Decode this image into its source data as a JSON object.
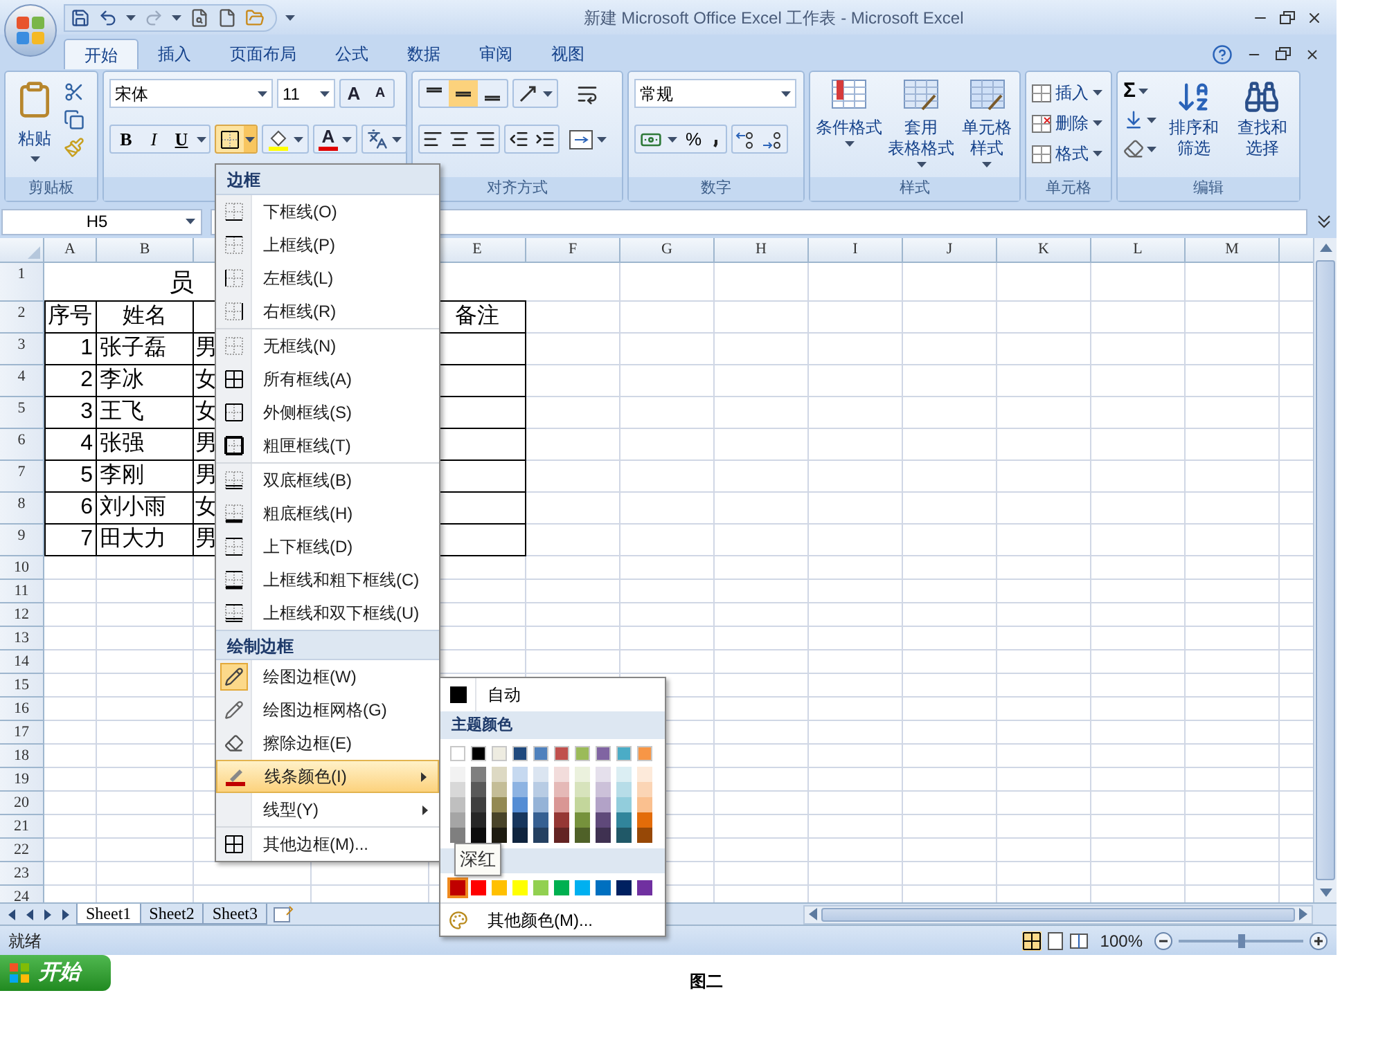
{
  "window": {
    "title": "新建 Microsoft Office Excel 工作表 - Microsoft Excel"
  },
  "tabs": [
    {
      "label": "开始",
      "selected": true
    },
    {
      "label": "插入",
      "selected": false
    },
    {
      "label": "页面布局",
      "selected": false
    },
    {
      "label": "公式",
      "selected": false
    },
    {
      "label": "数据",
      "selected": false
    },
    {
      "label": "审阅",
      "selected": false
    },
    {
      "label": "视图",
      "selected": false
    }
  ],
  "ribbon": {
    "clipboard": {
      "paste": "粘贴",
      "label": "剪贴板"
    },
    "font": {
      "name": "宋体",
      "size": "11",
      "grow": "A",
      "shrink": "A",
      "bold": "B",
      "italic": "I",
      "underline": "U",
      "font_color": "A"
    },
    "alignment": {
      "label": "对齐方式",
      "vertical": [
        {
          "selected": false
        },
        {
          "selected": true
        },
        {
          "selected": false
        }
      ]
    },
    "number": {
      "format": "常规",
      "percent": "%",
      "label": "数字"
    },
    "styles": {
      "buttons": [
        {
          "lines": [
            "条件格式"
          ]
        },
        {
          "lines": [
            "套用",
            "表格格式"
          ]
        },
        {
          "lines": [
            "单元格",
            "样式"
          ]
        }
      ],
      "label": "样式"
    },
    "cells": {
      "buttons": [
        "插入",
        "删除",
        "格式"
      ],
      "label": "单元格"
    },
    "editing": {
      "sum": "Σ",
      "buttons": [
        {
          "lines": [
            "排序和",
            "筛选"
          ]
        },
        {
          "lines": [
            "查找和",
            "选择"
          ]
        }
      ],
      "label": "编辑"
    }
  },
  "name_box": "H5",
  "grid": {
    "columns": [
      {
        "label": "A"
      },
      {
        "label": "B"
      },
      {},
      {},
      {
        "label": "E"
      },
      {
        "label": "F"
      },
      {
        "label": "G"
      },
      {
        "label": "H"
      },
      {
        "label": "I"
      },
      {
        "label": "J"
      },
      {
        "label": "K"
      },
      {
        "label": "L"
      },
      {
        "label": "M"
      }
    ],
    "row_numbers": [
      "1",
      "2",
      "3",
      "4",
      "5",
      "6",
      "7",
      "8",
      "9",
      "10",
      "11",
      "12",
      "13",
      "14",
      "15",
      "16",
      "17",
      "18",
      "19",
      "20",
      "21",
      "22",
      "23",
      "24"
    ],
    "title": "员",
    "header": [
      "序号",
      "姓名",
      "备注"
    ],
    "records": [
      {
        "no": "1",
        "name": "张子磊",
        "gender": "男"
      },
      {
        "no": "2",
        "name": "李冰",
        "gender": "女"
      },
      {
        "no": "3",
        "name": "王飞",
        "gender": "女"
      },
      {
        "no": "4",
        "name": "张强",
        "gender": "男"
      },
      {
        "no": "5",
        "name": "李刚",
        "gender": "男"
      },
      {
        "no": "6",
        "name": "刘小雨",
        "gender": "女"
      },
      {
        "no": "7",
        "name": "田大力",
        "gender": "男"
      }
    ]
  },
  "sheets": [
    {
      "label": "Sheet1",
      "selected": true
    },
    {
      "label": "Sheet2",
      "selected": false
    },
    {
      "label": "Sheet3",
      "selected": false
    }
  ],
  "status_bar": {
    "status": "就绪",
    "zoom": "100%",
    "zoom_slider": {
      "level": 0.5
    }
  },
  "border_menu": {
    "title": "边框",
    "groups": [
      [
        {
          "label": "下框线(O)",
          "kind": "bottom"
        },
        {
          "label": "上框线(P)",
          "kind": "top"
        },
        {
          "label": "左框线(L)",
          "kind": "left"
        },
        {
          "label": "右框线(R)",
          "kind": "right"
        }
      ],
      [
        {
          "label": "无框线(N)",
          "kind": "none"
        },
        {
          "label": "所有框线(A)",
          "kind": "all"
        },
        {
          "label": "外侧框线(S)",
          "kind": "outside"
        },
        {
          "label": "粗匣框线(T)",
          "kind": "thick_box"
        }
      ],
      [
        {
          "label": "双底框线(B)",
          "kind": "double_bottom"
        },
        {
          "label": "粗底框线(H)",
          "kind": "thick_bottom"
        },
        {
          "label": "上下框线(D)",
          "kind": "top_bottom"
        },
        {
          "label": "上框线和粗下框线(C)",
          "kind": "top_thick_bottom"
        },
        {
          "label": "上框线和双下框线(U)",
          "kind": "top_double_bottom"
        }
      ]
    ],
    "section": "绘制边框",
    "draw_items": [
      {
        "label": "绘图边框(W)",
        "kind": "draw_border",
        "checked": true,
        "selected": false,
        "submenu": false
      },
      {
        "label": "绘图边框网格(G)",
        "kind": "draw_grid",
        "checked": false,
        "selected": false,
        "submenu": false
      },
      {
        "label": "擦除边框(E)",
        "kind": "erase",
        "checked": false,
        "selected": false,
        "submenu": false
      },
      {
        "label": "线条颜色(I)",
        "kind": "line_color",
        "checked": false,
        "selected": true,
        "submenu": true
      },
      {
        "label": "线型(Y)",
        "kind": "line_style",
        "checked": false,
        "selected": false,
        "submenu": true
      },
      {
        "label": "其他边框(M)...",
        "kind": "more",
        "checked": false,
        "selected": false,
        "submenu": false
      }
    ]
  },
  "color_menu": {
    "automatic": {
      "label": "自动",
      "color": "#000000"
    },
    "theme_title": "主题颜色",
    "theme_colors": [
      {
        "color": "#ffffff",
        "shades": [
          {
            "color": "#f2f2f2"
          },
          {
            "color": "#d8d8d8"
          },
          {
            "color": "#bfbfbf"
          },
          {
            "color": "#a5a5a5"
          },
          {
            "color": "#7f7f7f"
          }
        ]
      },
      {
        "color": "#000000",
        "shades": [
          {
            "color": "#7f7f7f"
          },
          {
            "color": "#595959"
          },
          {
            "color": "#3f3f3f"
          },
          {
            "color": "#262626"
          },
          {
            "color": "#0c0c0c"
          }
        ]
      },
      {
        "color": "#eeece1",
        "shades": [
          {
            "color": "#ddd9c3"
          },
          {
            "color": "#c4bd97"
          },
          {
            "color": "#938953"
          },
          {
            "color": "#494429"
          },
          {
            "color": "#1d1b10"
          }
        ]
      },
      {
        "color": "#1f497d",
        "shades": [
          {
            "color": "#c6d9f0"
          },
          {
            "color": "#8db3e2"
          },
          {
            "color": "#548dd4"
          },
          {
            "color": "#17365d"
          },
          {
            "color": "#0f243e"
          }
        ]
      },
      {
        "color": "#4f81bd",
        "shades": [
          {
            "color": "#dbe5f1"
          },
          {
            "color": "#b8cce4"
          },
          {
            "color": "#95b3d7"
          },
          {
            "color": "#366092"
          },
          {
            "color": "#244061"
          }
        ]
      },
      {
        "color": "#c0504d",
        "shades": [
          {
            "color": "#f2dcdb"
          },
          {
            "color": "#e5b9b7"
          },
          {
            "color": "#d99694"
          },
          {
            "color": "#953734"
          },
          {
            "color": "#632423"
          }
        ]
      },
      {
        "color": "#9bbb59",
        "shades": [
          {
            "color": "#ebf1dd"
          },
          {
            "color": "#d7e3bc"
          },
          {
            "color": "#c3d69b"
          },
          {
            "color": "#76923c"
          },
          {
            "color": "#4f6128"
          }
        ]
      },
      {
        "color": "#8064a2",
        "shades": [
          {
            "color": "#e5e0ec"
          },
          {
            "color": "#ccc1d9"
          },
          {
            "color": "#b2a2c7"
          },
          {
            "color": "#5f497a"
          },
          {
            "color": "#3f3151"
          }
        ]
      },
      {
        "color": "#4bacc6",
        "shades": [
          {
            "color": "#dbeef3"
          },
          {
            "color": "#b7dde8"
          },
          {
            "color": "#92cddc"
          },
          {
            "color": "#31859b"
          },
          {
            "color": "#205867"
          }
        ]
      },
      {
        "color": "#f79646",
        "shades": [
          {
            "color": "#fdeada"
          },
          {
            "color": "#fbd5b5"
          },
          {
            "color": "#fac08f"
          },
          {
            "color": "#e36c09"
          },
          {
            "color": "#974806"
          }
        ]
      }
    ],
    "standard_colors": [
      {
        "color": "#c00000",
        "selected": true
      },
      {
        "color": "#ff0000",
        "selected": false
      },
      {
        "color": "#ffc000",
        "selected": false
      },
      {
        "color": "#ffff00",
        "selected": false
      },
      {
        "color": "#92d050",
        "selected": false
      },
      {
        "color": "#00b050",
        "selected": false
      },
      {
        "color": "#00b0f0",
        "selected": false
      },
      {
        "color": "#0070c0",
        "selected": false
      },
      {
        "color": "#002060",
        "selected": false
      },
      {
        "color": "#7030a0",
        "selected": false
      }
    ],
    "tooltip": "深红",
    "more": "其他颜色(M)..."
  },
  "taskbar": {
    "start": "开始"
  },
  "caption": "图二"
}
